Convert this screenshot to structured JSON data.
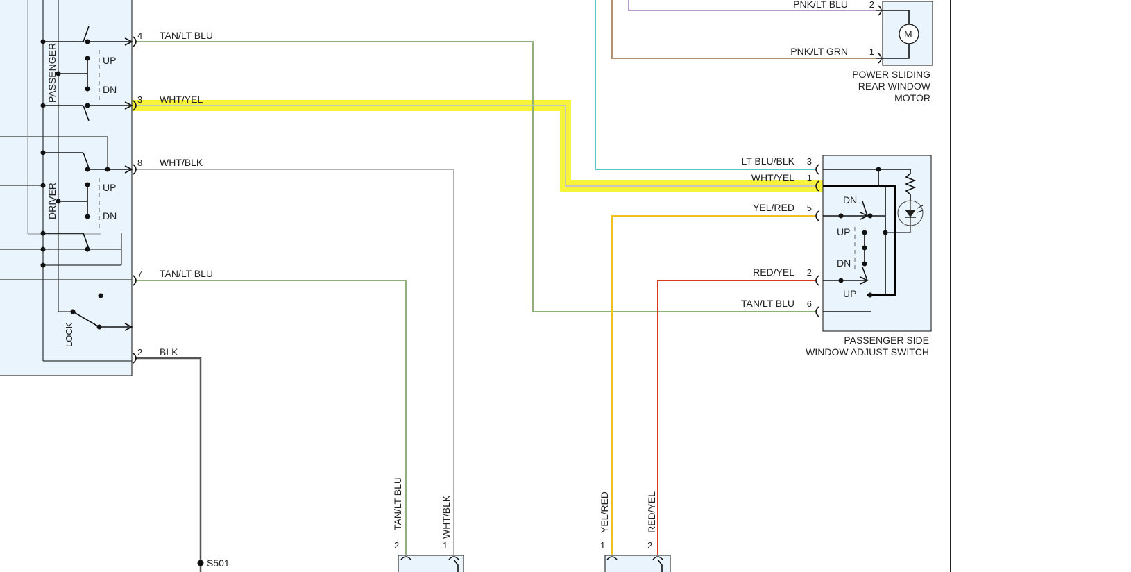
{
  "master_switch": {
    "passenger_label": "PASSENGER",
    "driver_label": "DRIVER",
    "lock_label": "LOCK",
    "up_label": "UP",
    "dn_label": "DN"
  },
  "wires": {
    "pin4": {
      "pin": "4",
      "label": "TAN/LT BLU"
    },
    "pin3": {
      "pin": "3",
      "label": "WHT/YEL"
    },
    "pin8": {
      "pin": "8",
      "label": "WHT/BLK"
    },
    "pin7": {
      "pin": "7",
      "label": "TAN/LT BLU"
    },
    "pin2": {
      "pin": "2",
      "label": "BLK"
    }
  },
  "rear_window_motor": {
    "title_line1": "POWER SLIDING",
    "title_line2": "REAR WINDOW",
    "title_line3": "MOTOR",
    "motor_symbol": "M",
    "pins": [
      {
        "pin": "2",
        "label": "PNK/LT BLU"
      },
      {
        "pin": "1",
        "label": "PNK/LT GRN"
      }
    ]
  },
  "passenger_switch": {
    "title_line1": "PASSENGER SIDE",
    "title_line2": "WINDOW ADJUST SWITCH",
    "pins": [
      {
        "pin": "3",
        "label": "LT BLU/BLK"
      },
      {
        "pin": "1",
        "label": "WHT/YEL"
      },
      {
        "pin": "5",
        "label": "YEL/RED"
      },
      {
        "pin": "2",
        "label": "RED/YEL"
      },
      {
        "pin": "6",
        "label": "TAN/LT BLU"
      }
    ],
    "dn_label": "DN",
    "up_label": "UP"
  },
  "bottom_connectors": {
    "left": [
      {
        "pin": "2",
        "label": "TAN/LT BLU"
      },
      {
        "pin": "1",
        "label": "WHT/BLK"
      }
    ],
    "right": [
      {
        "pin": "1",
        "label": "YEL/RED"
      },
      {
        "pin": "2",
        "label": "RED/YEL"
      }
    ]
  },
  "splice": {
    "label": "S501"
  },
  "colors": {
    "tan_lt_blu": "#8fb07a",
    "wht_yel": "#c8c8b8",
    "wht_blk": "#b0b0b0",
    "blk": "#555555",
    "lt_blu_blk": "#56c6c6",
    "pnk_lt_blu": "#b59ac8",
    "pnk_lt_grn": "#b59070",
    "yel_red": "#f0c020",
    "red_yel": "#d83a1a",
    "highlight": "#f6f33a"
  }
}
